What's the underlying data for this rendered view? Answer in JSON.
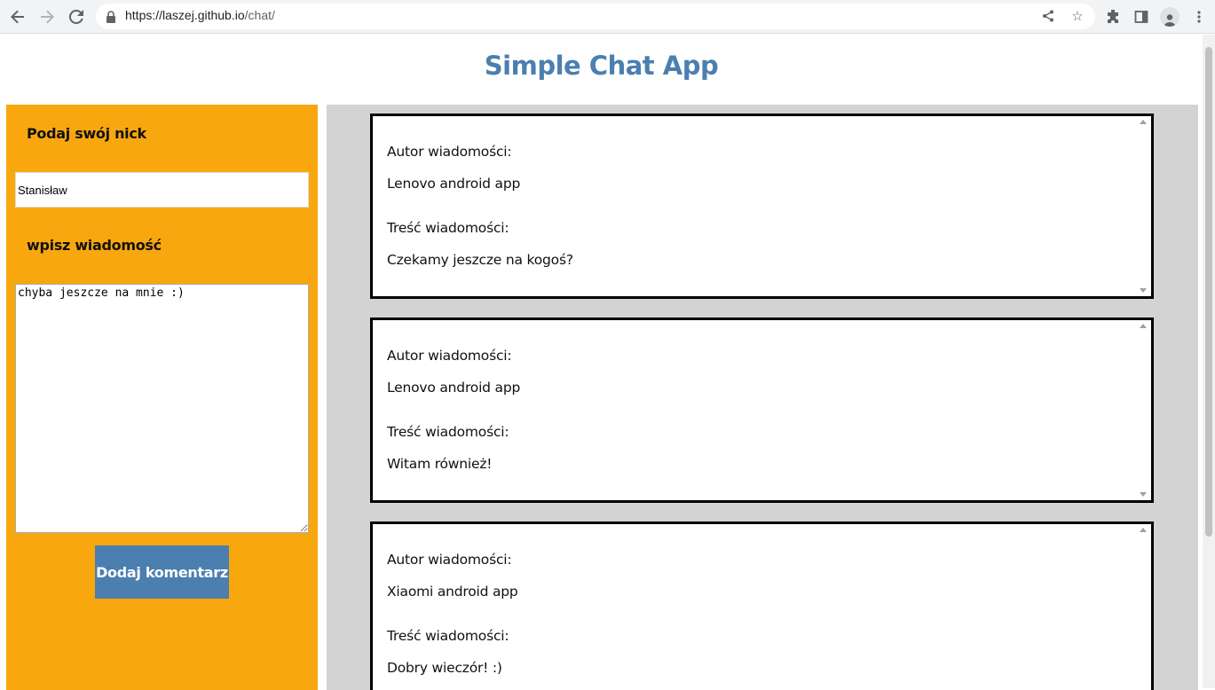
{
  "browser": {
    "url_host": "https://laszej.github.io",
    "url_path": "/chat/"
  },
  "app": {
    "title": "Simple Chat App"
  },
  "form": {
    "nick_label": "Podaj swój nick",
    "nick_value": "Stanisław",
    "message_label": "wpisz wiadomość",
    "message_value": "chyba jeszcze na mnie :)",
    "submit_label": "Dodaj komentarz"
  },
  "messages": [
    {
      "author_label": "Autor wiadomości:",
      "author": "Lenovo android app",
      "content_label": "Treść wiadomości:",
      "content": "Czekamy jeszcze na kogoś?"
    },
    {
      "author_label": "Autor wiadomości:",
      "author": "Lenovo android app",
      "content_label": "Treść wiadomości:",
      "content": "Witam również!"
    },
    {
      "author_label": "Autor wiadomości:",
      "author": "Xiaomi android app",
      "content_label": "Treść wiadomości:",
      "content": "Dobry wieczór! :)"
    }
  ],
  "colors": {
    "title": "#4b7fb0",
    "sidebar": "#f8a70f",
    "button": "#4b7fb0",
    "feed_bg": "#d3d3d3"
  }
}
